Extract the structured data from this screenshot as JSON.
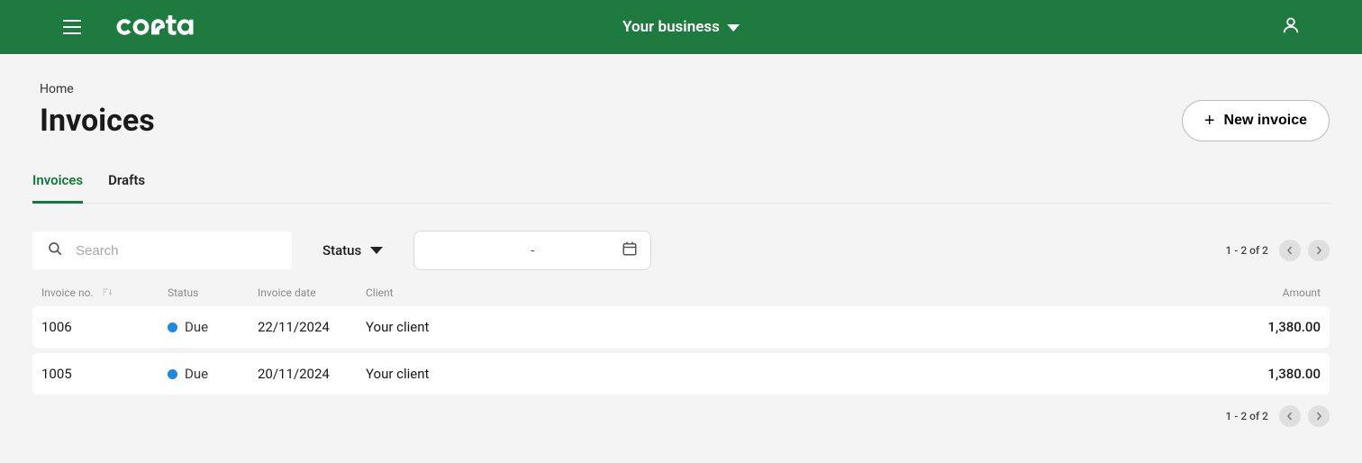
{
  "topnav": {
    "business_label": "Your business"
  },
  "breadcrumb": {
    "home": "Home"
  },
  "header": {
    "title": "Invoices",
    "new_button": "New invoice"
  },
  "tabs": {
    "invoices": "Invoices",
    "drafts": "Drafts",
    "active": "invoices"
  },
  "filters": {
    "search_placeholder": "Search",
    "status_label": "Status",
    "date_display": "-"
  },
  "columns": {
    "invoice_no": "Invoice no.",
    "status": "Status",
    "invoice_date": "Invoice date",
    "client": "Client",
    "amount": "Amount"
  },
  "rows": [
    {
      "no": "1006",
      "status": "Due",
      "date": "22/11/2024",
      "client": "Your client",
      "amount": "1,380.00"
    },
    {
      "no": "1005",
      "status": "Due",
      "date": "20/11/2024",
      "client": "Your client",
      "amount": "1,380.00"
    }
  ],
  "pagination": {
    "text": "1 - 2 of 2"
  },
  "colors": {
    "status_due": "#1e88e5"
  }
}
